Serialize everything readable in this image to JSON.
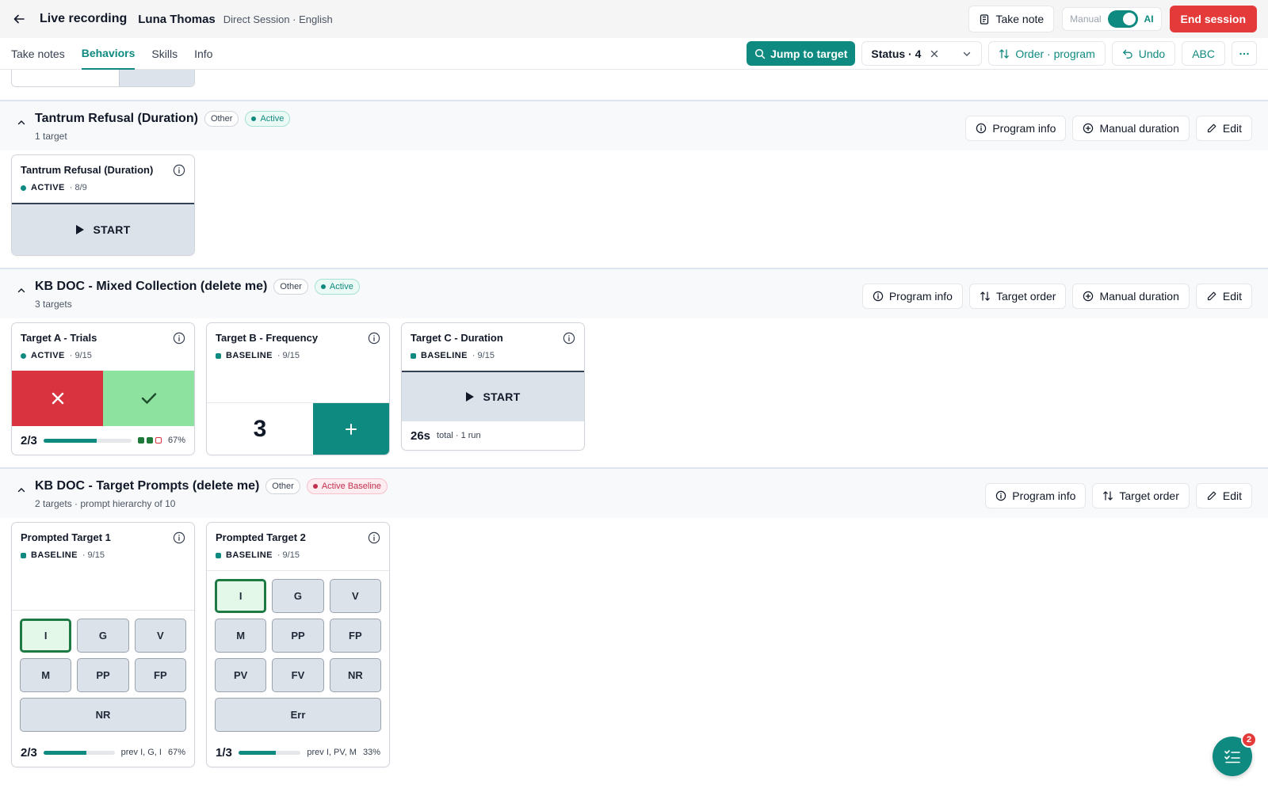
{
  "header": {
    "title": "Live recording",
    "patient": "Luna Thomas",
    "meta": "Direct Session · English",
    "take_note": "Take note",
    "toggle_off": "Manual",
    "toggle_on": "AI",
    "end_session": "End session"
  },
  "tabs": [
    {
      "label": "Take notes"
    },
    {
      "label": "Behaviors"
    },
    {
      "label": "Skills"
    },
    {
      "label": "Info"
    }
  ],
  "toolbar": {
    "jump": "Jump to target",
    "status": "Status · 4",
    "order": "Order · program",
    "undo": "Undo",
    "abc": "ABC"
  },
  "sections": [
    {
      "title": "Tantrum Refusal (Duration)",
      "tag": "Other",
      "status": "Active",
      "sub": "1 target",
      "actions": [
        "Program info",
        "Manual duration",
        "Edit"
      ],
      "cards": [
        {
          "title": "Tantrum Refusal (Duration)",
          "status": "ACTIVE",
          "frac": "· 8/9",
          "start": "START"
        }
      ]
    },
    {
      "title": "KB DOC - Mixed Collection (delete me)",
      "tag": "Other",
      "status": "Active",
      "sub": "3 targets",
      "actions": [
        "Program info",
        "Target order",
        "Manual duration",
        "Edit"
      ],
      "cards": [
        {
          "title": "Target A - Trials",
          "status": "ACTIVE",
          "frac": "· 9/15",
          "score": "2/3",
          "pct": "67%",
          "progress": 0.6
        },
        {
          "title": "Target B - Frequency",
          "status": "BASELINE",
          "frac": "· 9/15",
          "count": "3"
        },
        {
          "title": "Target C - Duration",
          "status": "BASELINE",
          "frac": "· 9/15",
          "start": "START",
          "total": "26s",
          "total_meta": "total · 1 run"
        }
      ]
    },
    {
      "title": "KB DOC - Target Prompts (delete me)",
      "tag": "Other",
      "status": "Active Baseline",
      "sub": "2 targets · prompt hierarchy of 10",
      "actions": [
        "Program info",
        "Target order",
        "Edit"
      ],
      "cards": [
        {
          "title": "Prompted Target 1",
          "status": "BASELINE",
          "frac": "· 9/15",
          "prompts": [
            "I",
            "G",
            "V",
            "M",
            "PP",
            "FP",
            "NR"
          ],
          "score": "2/3",
          "prev": "prev I, G, I",
          "pct": "67%",
          "progress": 0.6
        },
        {
          "title": "Prompted Target 2",
          "status": "BASELINE",
          "frac": "· 9/15",
          "prompts": [
            "I",
            "G",
            "V",
            "M",
            "PP",
            "FP",
            "PV",
            "FV",
            "NR",
            "Err"
          ],
          "score": "1/3",
          "prev": "prev I, PV, M",
          "pct": "33%",
          "progress": 0.6
        }
      ]
    }
  ],
  "fab": {
    "badge": "2"
  },
  "colors": {
    "accent": "#0f8a80",
    "danger": "#e53a3a",
    "correct": "#8ee2a0",
    "incorrect": "#d9333f"
  },
  "icons": [
    "arrow-left-icon",
    "clipboard-icon",
    "search-icon",
    "close-icon",
    "chevron-down-icon",
    "sort-icon",
    "undo-icon",
    "more-icon",
    "chevron-up-icon",
    "info-icon",
    "plus-circle-icon",
    "pencil-icon",
    "play-icon",
    "x-icon",
    "check-icon",
    "plus-icon",
    "checklist-icon"
  ]
}
